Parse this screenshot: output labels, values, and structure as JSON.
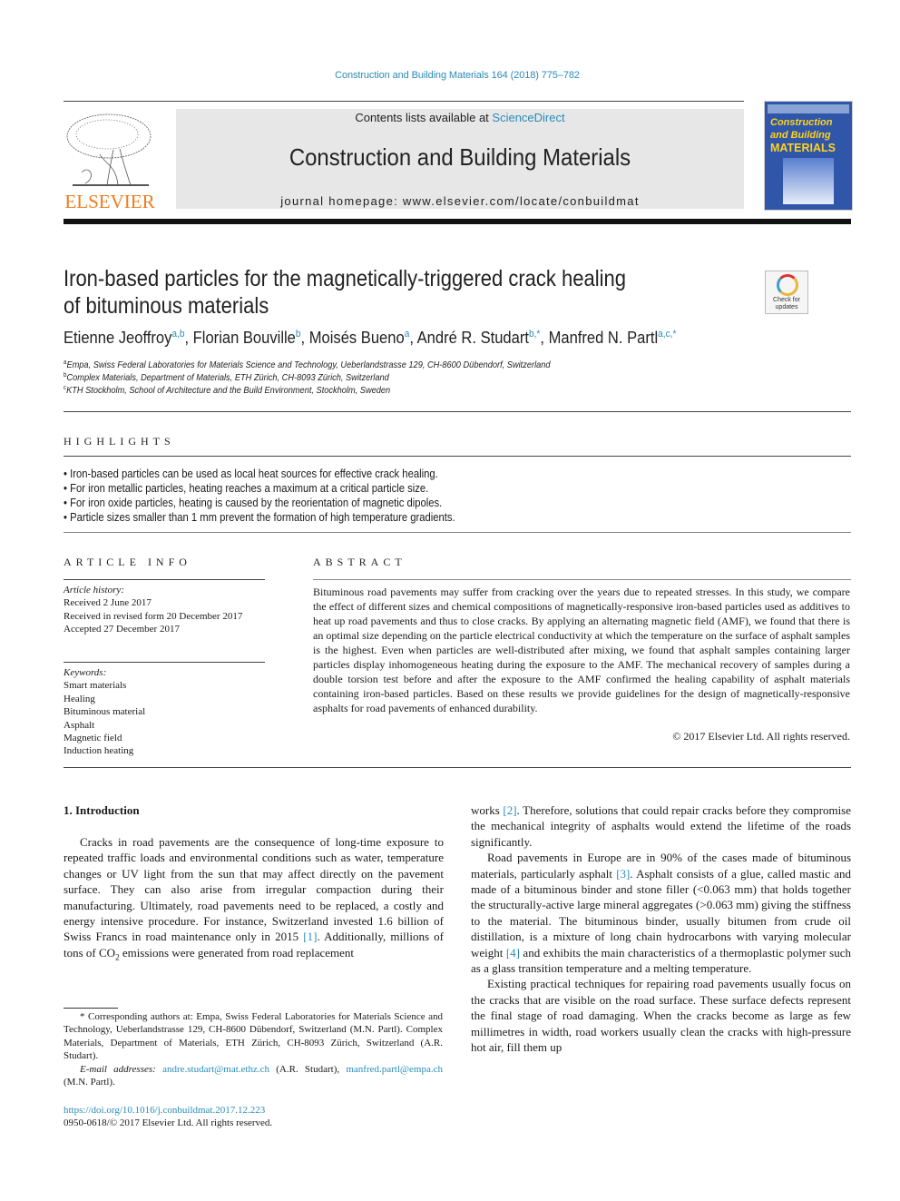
{
  "running_head": "Construction and Building Materials 164 (2018) 775–782",
  "masthead": {
    "publisher_logo_text": "ELSEVIER",
    "contents_prefix": "Contents lists available at ",
    "contents_link": "ScienceDirect",
    "journal_title": "Construction and Building Materials",
    "homepage": "journal homepage: www.elsevier.com/locate/conbuildmat",
    "cover": {
      "line1": "Construction",
      "line2": "and Building",
      "line3": "MATERIALS"
    }
  },
  "article": {
    "title_line1": "Iron-based particles for the magnetically-triggered crack healing",
    "title_line2": "of bituminous materials",
    "check_updates_label": "Check for updates",
    "authors": [
      {
        "name": "Etienne Jeoffroy",
        "sup": "a,b"
      },
      {
        "name": "Florian Bouville",
        "sup": "b"
      },
      {
        "name": "Moisés Bueno",
        "sup": "a"
      },
      {
        "name": "André R. Studart",
        "sup": "b,*"
      },
      {
        "name": "Manfred N. Partl",
        "sup": "a,c,*"
      }
    ],
    "affiliations": [
      {
        "mark": "a",
        "text": "Empa, Swiss Federal Laboratories for Materials Science and Technology, Ueberlandstrasse 129, CH-8600 Dübendorf, Switzerland"
      },
      {
        "mark": "b",
        "text": "Complex Materials, Department of Materials, ETH Zürich, CH-8093 Zürich, Switzerland"
      },
      {
        "mark": "c",
        "text": "KTH Stockholm, School of Architecture and the Build Environment, Stockholm, Sweden"
      }
    ]
  },
  "highlights": {
    "heading": "HIGHLIGHTS",
    "items": [
      "Iron-based particles can be used as local heat sources for effective crack healing.",
      "For iron metallic particles, heating reaches a maximum at a critical particle size.",
      "For iron oxide particles, heating is caused by the reorientation of magnetic dipoles.",
      "Particle sizes smaller than 1 mm prevent the formation of high temperature gradients."
    ]
  },
  "article_info": {
    "heading": "ARTICLE INFO",
    "history_label": "Article history:",
    "history": [
      "Received 2 June 2017",
      "Received in revised form 20 December 2017",
      "Accepted 27 December 2017"
    ],
    "keywords_label": "Keywords:",
    "keywords": [
      "Smart materials",
      "Healing",
      "Bituminous material",
      "Asphalt",
      "Magnetic field",
      "Induction heating"
    ]
  },
  "abstract": {
    "heading": "ABSTRACT",
    "text": "Bituminous road pavements may suffer from cracking over the years due to repeated stresses. In this study, we compare the effect of different sizes and chemical compositions of magnetically-responsive iron-based particles used as additives to heat up road pavements and thus to close cracks. By applying an alternating magnetic field (AMF), we found that there is an optimal size depending on the particle electrical conductivity at which the temperature on the surface of asphalt samples is the highest. Even when particles are well-distributed after mixing, we found that asphalt samples containing larger particles display inhomogeneous heating during the exposure to the AMF. The mechanical recovery of samples during a double torsion test before and after the exposure to the AMF confirmed the healing capability of asphalt materials containing iron-based particles. Based on these results we provide guidelines for the design of magnetically-responsive asphalts for road pavements of enhanced durability.",
    "copyright": "© 2017 Elsevier Ltd. All rights reserved."
  },
  "introduction": {
    "heading": "1. Introduction",
    "left_p1_a": "Cracks in road pavements are the consequence of long-time exposure to repeated traffic loads and environmental conditions such as water, temperature changes or UV light from the sun that may affect directly on the pavement surface. They can also arise from irregular compaction during their manufacturing. Ultimately, road pavements need to be replaced, a costly and energy intensive procedure. For instance, Switzerland invested 1.6 billion of Swiss Francs in road maintenance only in 2015 ",
    "ref1": "[1]",
    "left_p1_b": ". Additionally, millions of tons of CO",
    "co2_sub": "2",
    "left_p1_c": " emissions were generated from road replacement",
    "right_p1_a": "works ",
    "ref2": "[2]",
    "right_p1_b": ". Therefore, solutions that could repair cracks before they compromise the mechanical integrity of asphalts would extend the lifetime of the roads significantly.",
    "right_p2_a": "Road pavements in Europe are in 90% of the cases made of bituminous materials, particularly asphalt ",
    "ref3": "[3]",
    "right_p2_b": ". Asphalt consists of a glue, called mastic and made of a bituminous binder and stone filler (<0.063 mm) that holds together the structurally-active large mineral aggregates (>0.063 mm) giving the stiffness to the material. The bituminous binder, usually bitumen from crude oil distillation, is a mixture of long chain hydrocarbons with varying molecular weight ",
    "ref4": "[4]",
    "right_p2_c": " and exhibits the main characteristics of a thermoplastic polymer such as a glass transition temperature and a melting temperature.",
    "right_p3": "Existing practical techniques for repairing road pavements usually focus on the cracks that are visible on the road surface. These surface defects represent the final stage of road damaging. When the cracks become as large as few millimetres in width, road workers usually clean the cracks with high-pressure hot air, fill them up"
  },
  "footnote": {
    "corresponding": "* Corresponding authors at: Empa, Swiss Federal Laboratories for Materials Science and Technology, Ueberlandstrasse 129, CH-8600 Dübendorf, Switzerland (M.N. Partl). Complex Materials, Department of Materials, ETH Zürich, CH-8093 Zürich, Switzerland (A.R. Studart).",
    "email_label": "E-mail addresses:",
    "email1": "andre.studart@mat.ethz.ch",
    "email1_owner": " (A.R. Studart), ",
    "email2": "manfred.partl@empa.ch",
    "email2_owner": " (M.N. Partl).",
    "doi": "https://doi.org/10.1016/j.conbuildmat.2017.12.223",
    "issn_copyright": "0950-0618/© 2017 Elsevier Ltd. All rights reserved."
  }
}
